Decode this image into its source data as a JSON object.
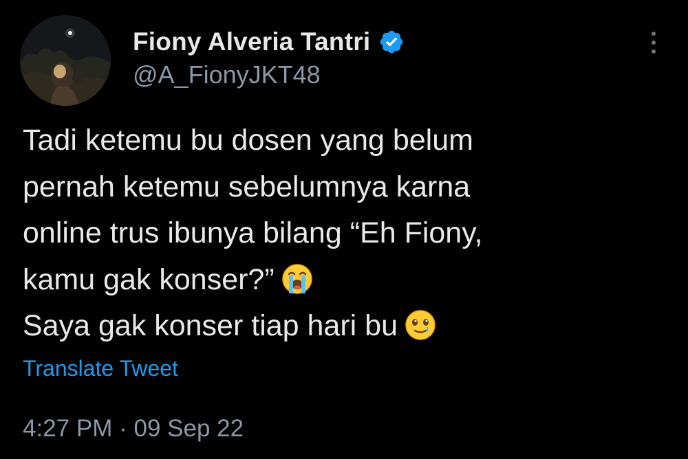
{
  "author": {
    "display_name": "Fiony Alveria Tantri",
    "handle": "@A_FionyJKT48",
    "verified_icon": "verified-badge-icon",
    "avatar_icon": "profile-avatar"
  },
  "menu": {
    "icon": "more-vertical-icon"
  },
  "tweet": {
    "lines": [
      "Tadi ketemu bu dosen yang belum",
      "pernah ketemu sebelumnya karna",
      "online trus ibunya bilang “Eh Fiony,",
      "kamu gak konser?”",
      "Saya gak konser tiap hari bu"
    ],
    "emoji_line4": "loudly-crying-face-emoji",
    "emoji_line5": "face-holding-back-tears-emoji"
  },
  "actions": {
    "translate_label": "Translate Tweet"
  },
  "meta": {
    "time": "4:27 PM",
    "separator": "·",
    "date": "09 Sep 22"
  },
  "colors": {
    "background": "#000000",
    "text_primary": "#e7e9ea",
    "text_secondary": "#8b98a5",
    "accent": "#1d9bf0"
  }
}
